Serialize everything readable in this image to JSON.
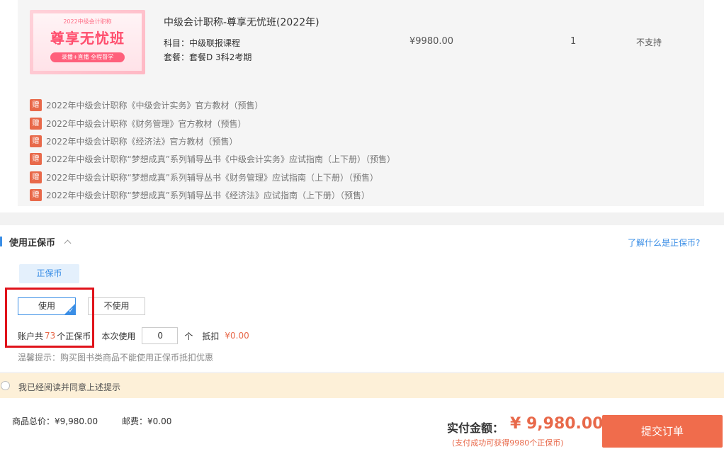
{
  "product": {
    "thumbnail": {
      "subtitle": "2022中级会计职称",
      "title": "尊享无忧班",
      "badge": "录播+直播 全程督学"
    },
    "title": "中级会计职称-尊享无忧班(2022年)",
    "subject": "科目：中级联报课程",
    "package": "套餐：套餐D 3科2考期",
    "price": "¥9980.00",
    "quantity": "1",
    "return_policy": "不支持",
    "gift_tag": "赠",
    "gifts": [
      "2022年中级会计职称《中级会计实务》官方教材（预售）",
      "2022年中级会计职称《财务管理》官方教材（预售）",
      "2022年中级会计职称《经济法》官方教材（预售）",
      "2022年中级会计职称“梦想成真”系列辅导丛书《中级会计实务》应试指南（上下册）（预售）",
      "2022年中级会计职称“梦想成真”系列辅导丛书《财务管理》应试指南（上下册）（预售）",
      "2022年中级会计职称“梦想成真”系列辅导丛书《经济法》应试指南（上下册）（预售）"
    ]
  },
  "coin": {
    "heading": "使用正保币",
    "help_link": "了解什么是正保币?",
    "tab": "正保币",
    "use_label": "使用",
    "no_use_label": "不使用",
    "selected": "使用",
    "account_prefix": "账户共",
    "account_count": "73",
    "account_suffix": "个正保币",
    "use_prefix": "本次使用",
    "use_value": "0",
    "use_unit": "个",
    "deduct_label": "抵扣",
    "deduct_value": "¥0.00",
    "tip": "温馨提示：购买图书类商品不能使用正保币抵扣优惠"
  },
  "agreement": {
    "text": "我已经阅读并同意上述提示",
    "checked": false
  },
  "footer": {
    "total": "商品总价：¥9,980.00",
    "shipping": "邮费：¥0.00",
    "pay_label": "实付金额：",
    "pay_amount": "¥ 9,980.00",
    "pay_note": "(支付成功可获得9980个正保币)",
    "submit_label": "提交订单"
  },
  "colors": {
    "accent_blue": "#3a8ee6",
    "price_red": "#e8694a",
    "submit_bg": "#f06c4c",
    "highlight_red": "#e0131b"
  }
}
